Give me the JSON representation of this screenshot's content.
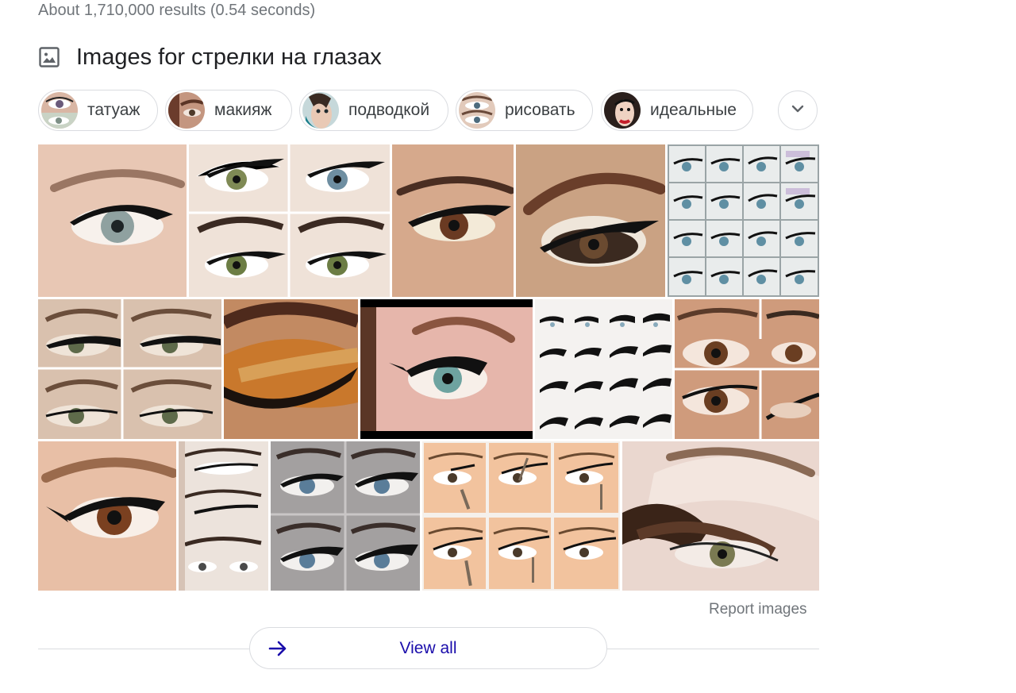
{
  "results_stats": "About 1,710,000 results (0.54 seconds)",
  "section": {
    "icon": "image-icon",
    "title": "Images for стрелки на глазах"
  },
  "chips": [
    {
      "label": "татуаж"
    },
    {
      "label": "макияж"
    },
    {
      "label": "подводкой"
    },
    {
      "label": "рисовать"
    },
    {
      "label": "идеальные"
    }
  ],
  "chips_more_icon": "chevron-down-icon",
  "report_images": "Report images",
  "view_all": {
    "label": "View all",
    "icon": "arrow-right-icon"
  },
  "colors": {
    "link_blue": "#1a0dab",
    "arrow_blue": "#1a0dab",
    "secondary_text": "#70757a",
    "border": "#dadce0",
    "skin": "#e6c3ad",
    "brow": "#8a6048",
    "liner": "#111111"
  }
}
